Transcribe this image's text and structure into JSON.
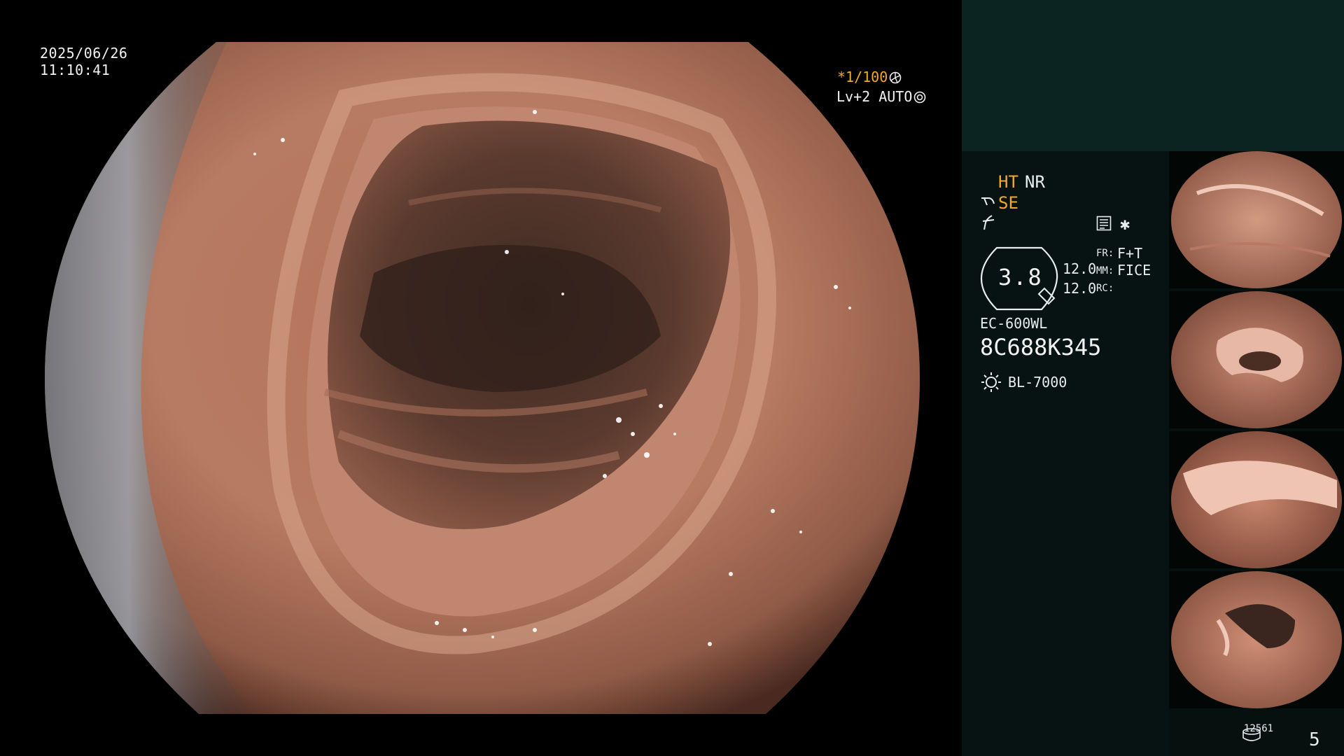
{
  "overlay": {
    "date": "2025/06/26",
    "time": "11:10:41",
    "shutter": "*1/100",
    "level": "Lv+2 AUTO"
  },
  "status": {
    "ht": "HT",
    "nr": "NR",
    "se": "SE",
    "zoom": "3.8",
    "value_a": "12.0",
    "value_b": "12.0",
    "fr_key": "FR:",
    "fr_value": "F+T",
    "mm_key": "MM:",
    "mm_value": "FICE",
    "rc_key": "RC:",
    "scope_model": "EC-600WL",
    "scope_serial": "8C688K345",
    "light_source": "BL-7000",
    "storage_count": "12561",
    "page_number": "5"
  },
  "thumbnails": [
    {
      "label": "captured-frame-1"
    },
    {
      "label": "captured-frame-2"
    },
    {
      "label": "captured-frame-3"
    },
    {
      "label": "captured-frame-4"
    }
  ],
  "colors": {
    "accent": "#f4a92a",
    "panel_top": "#0b2422",
    "panel_info": "#061312",
    "text": "#e8eef0"
  }
}
